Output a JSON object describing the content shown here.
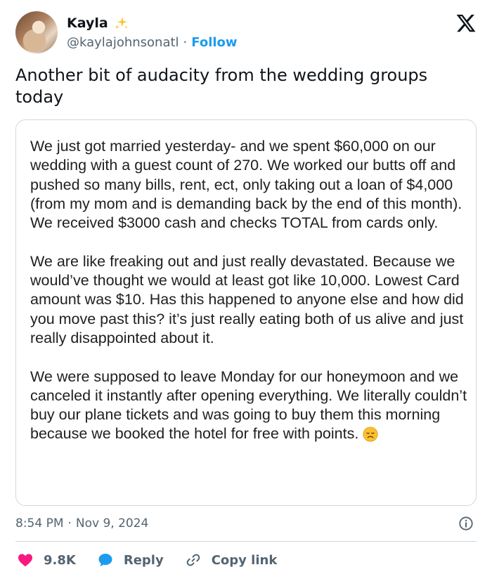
{
  "author": {
    "name": "Kayla",
    "handle": "@kaylajohnsonatl",
    "separator": "·",
    "follow_label": "Follow"
  },
  "icons": {
    "sparkle": "sparkles-icon",
    "x_logo": "x-logo-icon",
    "info": "info-icon",
    "like": "heart-icon",
    "reply": "speech-bubble-icon",
    "copy": "link-icon",
    "emoji": "disappointed-face-icon"
  },
  "tweet": {
    "text": "Another bit of audacity from the wedding groups today"
  },
  "screenshot": {
    "paragraphs": [
      "We just got married yesterday- and we spent $60,000 on our wedding with a guest count of 270. We worked our butts off and pushed so many bills, rent, ect, only taking out a loan of $4,000 (from my mom and is demanding back by the end of this month). We received $3000 cash and checks TOTAL from cards only.",
      "We are like freaking out and just really devastated. Because we would’ve thought we would at least got like 10,000. Lowest Card amount was $10. Has this happened to anyone else and how did you move past this?  it’s just really eating both of us alive and just really disappointed about it.",
      "We were   supposed to leave Monday for our honeymoon and we canceled it instantly after opening everything. We literally couldn’t buy our plane tickets and was going to buy them this morning because we booked the hotel for free with points."
    ]
  },
  "meta": {
    "time": "8:54 PM",
    "separator": "·",
    "date": "Nov 9, 2024"
  },
  "actions": {
    "likes": "9.8K",
    "reply_label": "Reply",
    "copy_label": "Copy link"
  },
  "colors": {
    "accent": "#1d9bf0",
    "like": "#f91880",
    "text": "#0f1419",
    "muted": "#536471",
    "border": "#cfd9de"
  }
}
